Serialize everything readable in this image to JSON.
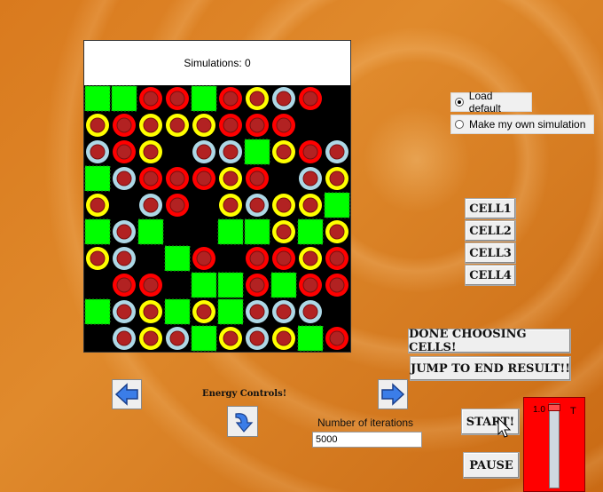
{
  "simulation": {
    "label": "Simulations: 0",
    "grid": [
      [
        "G",
        "G",
        "R",
        "R",
        "G",
        "R",
        "Y",
        "B",
        "R",
        "E"
      ],
      [
        "Y",
        "R",
        "Y",
        "Y",
        "Y",
        "R",
        "R",
        "R",
        "E",
        "E"
      ],
      [
        "B",
        "R",
        "Y",
        "E",
        "B",
        "B",
        "G",
        "Y",
        "R",
        "B"
      ],
      [
        "G",
        "B",
        "R",
        "R",
        "R",
        "Y",
        "R",
        "E",
        "B",
        "Y"
      ],
      [
        "Y",
        "E",
        "B",
        "R",
        "E",
        "Y",
        "B",
        "Y",
        "Y",
        "G"
      ],
      [
        "G",
        "B",
        "G",
        "E",
        "E",
        "G",
        "G",
        "Y",
        "G",
        "Y"
      ],
      [
        "Y",
        "B",
        "E",
        "G",
        "R",
        "E",
        "R",
        "R",
        "Y",
        "R"
      ],
      [
        "E",
        "R",
        "R",
        "E",
        "G",
        "G",
        "R",
        "G",
        "R",
        "R"
      ],
      [
        "G",
        "B",
        "Y",
        "G",
        "Y",
        "G",
        "B",
        "B",
        "B",
        "E"
      ],
      [
        "E",
        "B",
        "Y",
        "B",
        "G",
        "Y",
        "B",
        "Y",
        "G",
        "R"
      ]
    ],
    "legend": {
      "G": "green square cell",
      "R": "red ring cell",
      "Y": "yellow ring cell",
      "B": "light-blue ring cell",
      "E": "empty"
    }
  },
  "colors": {
    "green": "#00ff00",
    "green_border": "#1a8a1a",
    "red_ring": "#ff0000",
    "yellow_ring": "#ffff00",
    "blue_ring": "#add8e6",
    "inner": "#b22222",
    "board_bg": "#000000"
  },
  "options": {
    "load_default": "Load default",
    "make_own": "Make my own simulation",
    "selected": "load_default"
  },
  "cell_buttons": [
    "CELL1",
    "CELL2",
    "CELL3",
    "CELL4"
  ],
  "buttons": {
    "done": "DONE CHOOSING CELLS!",
    "jump": "JUMP TO END RESULT!!",
    "start": "START!",
    "pause": "PAUSE"
  },
  "energy_label": "Energy Controls!",
  "iterations": {
    "label": "Number of iterations",
    "value": "5000"
  },
  "thermometer": {
    "value_label": "1.0",
    "t_label": "T",
    "level": 1.0
  },
  "icons": {
    "prev": "left-arrow-icon",
    "next": "right-arrow-icon",
    "energy": "curved-down-arrow-icon",
    "cursor": "mouse-pointer-icon"
  }
}
